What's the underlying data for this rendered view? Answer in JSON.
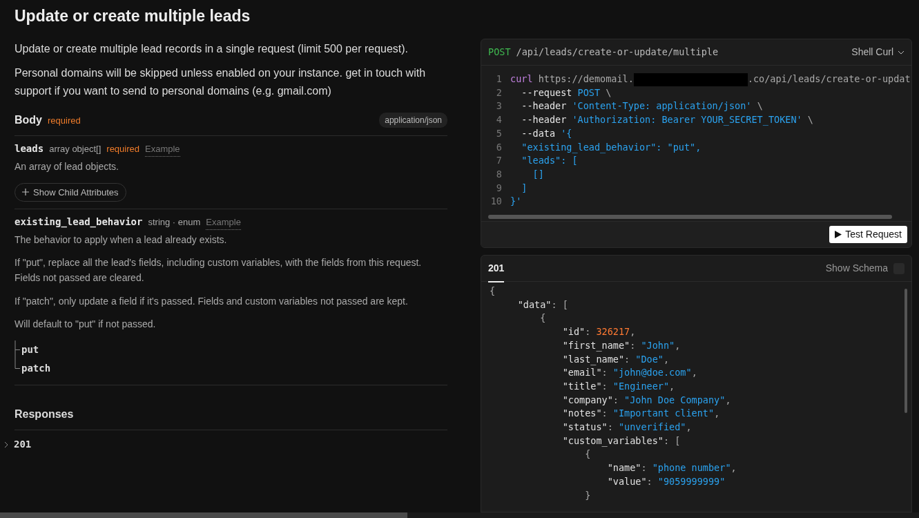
{
  "title": "Update or create multiple leads",
  "intro": [
    "Update or create multiple lead records in a single request (limit 500 per request).",
    "Personal domains will be skipped unless enabled on your instance. get in touch with support if you want to send to personal domains (e.g. gmail.com)"
  ],
  "body": {
    "label": "Body",
    "required": "required",
    "content_type": "application/json"
  },
  "params": [
    {
      "name": "leads",
      "type": "array object[]",
      "required": "required",
      "example": "Example",
      "descriptions": [
        "An array of lead objects."
      ],
      "child_button": "Show Child Attributes"
    },
    {
      "name": "existing_lead_behavior",
      "type": "string · enum",
      "example": "Example",
      "descriptions": [
        "The behavior to apply when a lead already exists.",
        "If \"put\", replace all the lead's fields, including custom variables, with the fields from this request. Fields not passed are cleared.",
        "If \"patch\", only update a field if it's passed. Fields and custom variables not passed are kept.",
        "Will default to \"put\" if not passed."
      ],
      "enum_values": [
        "put",
        "patch"
      ]
    }
  ],
  "responses": {
    "title": "Responses",
    "items": [
      {
        "code": "201",
        "expanded": false
      }
    ]
  },
  "request": {
    "method": "POST",
    "path": "/api/leads/create-or-update/multiple",
    "language": "Shell Curl",
    "button": "Test Request",
    "lines": [
      {
        "n": "1",
        "tokens": [
          {
            "kind": "kw",
            "text": "curl"
          },
          {
            "kind": "plain",
            "text": " https://demomail."
          },
          {
            "kind": "redacted"
          },
          {
            "kind": "plain",
            "text": ".co/api/leads/create-or-updat"
          }
        ]
      },
      {
        "n": "2",
        "tokens": [
          {
            "kind": "flag",
            "text": "  --request"
          },
          {
            "kind": "str",
            "text": " POST"
          },
          {
            "kind": "plain",
            "text": " \\"
          }
        ]
      },
      {
        "n": "3",
        "tokens": [
          {
            "kind": "flag",
            "text": "  --header"
          },
          {
            "kind": "str",
            "text": " 'Content-Type: application/json'"
          },
          {
            "kind": "plain",
            "text": " \\"
          }
        ]
      },
      {
        "n": "4",
        "tokens": [
          {
            "kind": "flag",
            "text": "  --header"
          },
          {
            "kind": "str",
            "text": " 'Authorization: Bearer YOUR_SECRET_TOKEN'"
          },
          {
            "kind": "plain",
            "text": " \\"
          }
        ]
      },
      {
        "n": "5",
        "tokens": [
          {
            "kind": "flag",
            "text": "  --data"
          },
          {
            "kind": "str",
            "text": " '{"
          }
        ]
      },
      {
        "n": "6",
        "tokens": [
          {
            "kind": "str",
            "text": "  \"existing_lead_behavior\": \"put\","
          }
        ]
      },
      {
        "n": "7",
        "tokens": [
          {
            "kind": "str",
            "text": "  \"leads\": ["
          }
        ]
      },
      {
        "n": "8",
        "tokens": [
          {
            "kind": "str",
            "text": "    []"
          }
        ]
      },
      {
        "n": "9",
        "tokens": [
          {
            "kind": "str",
            "text": "  ]"
          }
        ]
      },
      {
        "n": "10",
        "tokens": [
          {
            "kind": "str",
            "text": "}'"
          }
        ]
      }
    ]
  },
  "response": {
    "tabs": [
      {
        "label": "201",
        "selected": true
      }
    ],
    "schema_label": "Show Schema",
    "schema_checked": false,
    "lines": [
      [
        {
          "kind": "punct",
          "text": "{"
        }
      ],
      [
        {
          "kind": "key",
          "text": "     \"data\""
        },
        {
          "kind": "punct",
          "text": ": ["
        }
      ],
      [
        {
          "kind": "punct",
          "text": "         {"
        }
      ],
      [
        {
          "kind": "key",
          "text": "             \"id\""
        },
        {
          "kind": "punct",
          "text": ": "
        },
        {
          "kind": "num",
          "text": "326217"
        },
        {
          "kind": "punct",
          "text": ","
        }
      ],
      [
        {
          "kind": "key",
          "text": "             \"first_name\""
        },
        {
          "kind": "punct",
          "text": ": "
        },
        {
          "kind": "str",
          "text": "\"John\""
        },
        {
          "kind": "punct",
          "text": ","
        }
      ],
      [
        {
          "kind": "key",
          "text": "             \"last_name\""
        },
        {
          "kind": "punct",
          "text": ": "
        },
        {
          "kind": "str",
          "text": "\"Doe\""
        },
        {
          "kind": "punct",
          "text": ","
        }
      ],
      [
        {
          "kind": "key",
          "text": "             \"email\""
        },
        {
          "kind": "punct",
          "text": ": "
        },
        {
          "kind": "str",
          "text": "\"john@doe.com\""
        },
        {
          "kind": "punct",
          "text": ","
        }
      ],
      [
        {
          "kind": "key",
          "text": "             \"title\""
        },
        {
          "kind": "punct",
          "text": ": "
        },
        {
          "kind": "str",
          "text": "\"Engineer\""
        },
        {
          "kind": "punct",
          "text": ","
        }
      ],
      [
        {
          "kind": "key",
          "text": "             \"company\""
        },
        {
          "kind": "punct",
          "text": ": "
        },
        {
          "kind": "str",
          "text": "\"John Doe Company\""
        },
        {
          "kind": "punct",
          "text": ","
        }
      ],
      [
        {
          "kind": "key",
          "text": "             \"notes\""
        },
        {
          "kind": "punct",
          "text": ": "
        },
        {
          "kind": "str",
          "text": "\"Important client\""
        },
        {
          "kind": "punct",
          "text": ","
        }
      ],
      [
        {
          "kind": "key",
          "text": "             \"status\""
        },
        {
          "kind": "punct",
          "text": ": "
        },
        {
          "kind": "str",
          "text": "\"unverified\""
        },
        {
          "kind": "punct",
          "text": ","
        }
      ],
      [
        {
          "kind": "key",
          "text": "             \"custom_variables\""
        },
        {
          "kind": "punct",
          "text": ": ["
        }
      ],
      [
        {
          "kind": "punct",
          "text": "                 {"
        }
      ],
      [
        {
          "kind": "key",
          "text": "                     \"name\""
        },
        {
          "kind": "punct",
          "text": ": "
        },
        {
          "kind": "str",
          "text": "\"phone number\""
        },
        {
          "kind": "punct",
          "text": ","
        }
      ],
      [
        {
          "kind": "key",
          "text": "                     \"value\""
        },
        {
          "kind": "punct",
          "text": ": "
        },
        {
          "kind": "str",
          "text": "\"9059999999\""
        }
      ],
      [
        {
          "kind": "punct",
          "text": "                 }"
        }
      ]
    ]
  }
}
